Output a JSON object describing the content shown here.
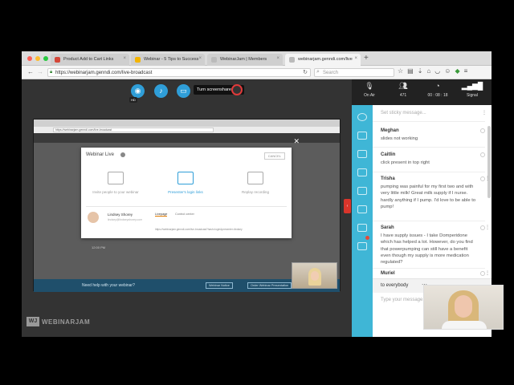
{
  "colors": {
    "accent": "#2f9ed8",
    "sidebar": "#3fb6d6",
    "alert": "#e03a3a"
  },
  "browser": {
    "tabs": [
      {
        "label": "Product Add to Cart Links",
        "icon": "gmail-icon",
        "color": "#d44638",
        "active": false
      },
      {
        "label": "Webinar - 5 Tips to Success",
        "icon": "slides-icon",
        "color": "#f4b400",
        "active": false
      },
      {
        "label": "WebinarJam | Members",
        "icon": "page-icon",
        "color": "#bbbbbb",
        "active": false
      },
      {
        "label": "webinarjam.genndi.com/live",
        "icon": "page-icon",
        "color": "#bbbbbb",
        "active": true
      }
    ],
    "url": "https://webinarjam.genndi.com/live-broadcast",
    "search_placeholder": "Search"
  },
  "controls": {
    "hd_badge": "HD",
    "tooltip": "Turn screenshare OFF"
  },
  "shared_screen": {
    "url": "https://webinarjam.genndi.com/live-broadcast",
    "modal": {
      "title": "Webinar Live",
      "cancel": "CANCEL",
      "options": [
        {
          "label": "Invite people to your webinar",
          "selected": false
        },
        {
          "label": "Presenter's login links",
          "selected": true
        },
        {
          "label": "Replay recording",
          "selected": false
        }
      ],
      "presenter_name": "Lindsey Shorey",
      "presenter_email": "lindsey@lindseyshorey.com",
      "tabs": [
        "Livepage",
        "Control center"
      ],
      "link": "https://webinarjam.genndi.com/live-broadcast?hash=login&presenter=lindsey"
    },
    "timestamp": "12:00 PM",
    "footer_text": "Need help with your webinar?",
    "footer_buttons": [
      "Webinar Notice",
      "Order Webinar Presentation"
    ]
  },
  "branding": {
    "logo_mark": "WJ",
    "logo_text": "WEBINARJAM"
  },
  "stats": [
    {
      "label": "On Air",
      "icon": "mic-icon"
    },
    {
      "label": "471",
      "icon": "attendees-icon"
    },
    {
      "label": "00 : 08 : 18",
      "icon": "clock-icon"
    },
    {
      "label": "Signal",
      "icon": "signal-icon"
    }
  ],
  "chat": {
    "sticky_placeholder": "Set sticky message...",
    "messages": [
      {
        "name": "Meghan",
        "text": "slides not working"
      },
      {
        "name": "Caitlin",
        "text": "click present in top right"
      },
      {
        "name": "Trisha",
        "text": "pumping was painful for my first two and with very little milk! Great milk supply if I nurse. hardly anything if I pump. I'd love to be able to pump!"
      },
      {
        "name": "Sarah",
        "text": "I have supply issues - I take Domperidone which has helped a lot. However, do you find that powerpumping can still have a benefit even though my supply is more medication regulated?"
      },
      {
        "name": "Muriel",
        "text": ""
      }
    ],
    "to_label": "to everybody",
    "type_placeholder": "Type your message..."
  }
}
